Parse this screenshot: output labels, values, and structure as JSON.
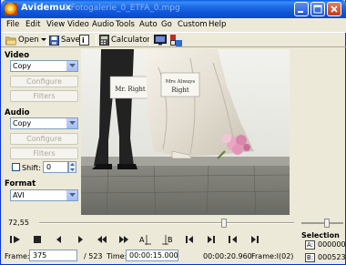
{
  "window": {
    "app_name": "Avidemux",
    "file_name": "2 Fotogalerie_0_ETFA_0.mpg"
  },
  "menu": [
    "File",
    "Edit",
    "View",
    "Video",
    "Audio",
    "Tools",
    "Auto",
    "Go",
    "Custom",
    "Help"
  ],
  "toolbar": {
    "open_label": "Open",
    "save_label": "Save",
    "calculator_label": "Calculator"
  },
  "video": {
    "section_label": "Video",
    "codec": "Copy",
    "configure_label": "Configure",
    "filters_label": "Filters"
  },
  "audio": {
    "section_label": "Audio",
    "codec": "Copy",
    "configure_label": "Configure",
    "filters_label": "Filters",
    "shift_label": "Shift:",
    "shift_value": "0"
  },
  "format": {
    "section_label": "Format",
    "container": "AVI"
  },
  "preview": {
    "sign_left": "Mr. Right",
    "sign_right_line1": "Mrs Always",
    "sign_right_line2": "Right"
  },
  "navigation": {
    "position_percent": "72,55",
    "position_fraction": 0.7255
  },
  "selection": {
    "label": "Selection",
    "a_marker": "A:",
    "a_value": "000000",
    "b_marker": "B:",
    "b_value": "000523"
  },
  "status": {
    "frame_label": "Frame:",
    "frame_value": "375",
    "total_frames": "/ 523",
    "time_label": "Time:",
    "time_value": "00:00:15.000",
    "duration": "00:00:20.960",
    "frame_type": "Frame:I(02)"
  },
  "colors": {
    "titlebar": "#0A5DDF",
    "window_bg": "#ECE9D8"
  }
}
